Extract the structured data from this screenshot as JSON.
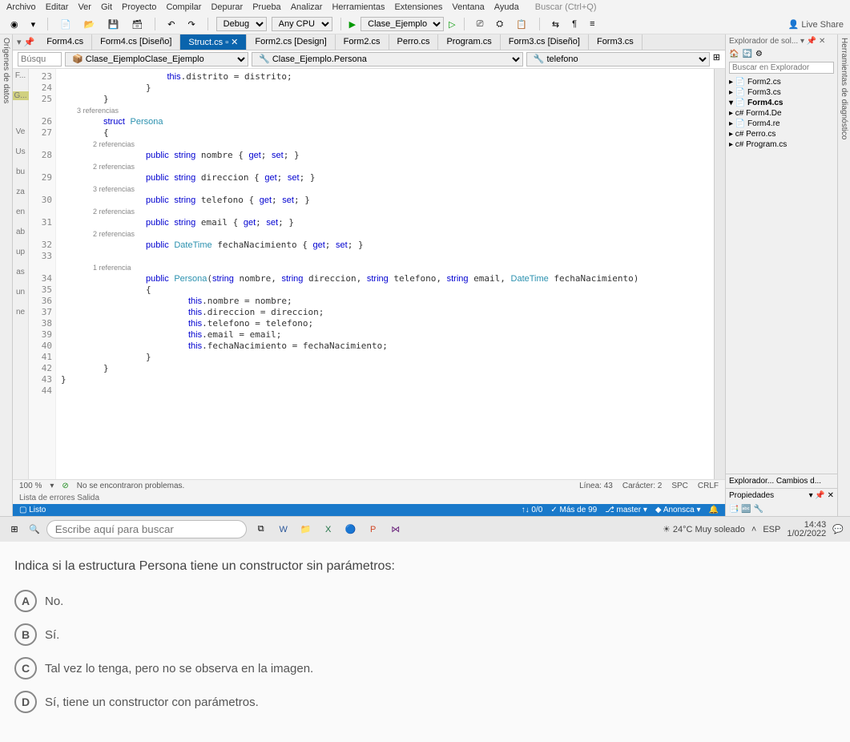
{
  "menubar": [
    "Archivo",
    "Editar",
    "Ver",
    "Git",
    "Proyecto",
    "Compilar",
    "Depurar",
    "Prueba",
    "Analizar",
    "Herramientas",
    "Extensiones",
    "Ventana",
    "Ayuda"
  ],
  "menuSearch": "Buscar (Ctrl+Q)",
  "toolbar": {
    "debug": "Debug",
    "anycpu": "Any CPU",
    "run": "Clase_Ejemplo",
    "liveshare": "Live Share"
  },
  "docTabs": [
    "Form4.cs",
    "Form4.cs [Diseño]",
    "Struct.cs",
    "Form2.cs [Design]",
    "Form2.cs",
    "Perro.cs",
    "Program.cs",
    "Form3.cs [Diseño]",
    "Form3.cs"
  ],
  "activeTabIndex": 2,
  "nav": {
    "searchPlaceholder": "Búsqu",
    "project": "Clase_Ejemplo",
    "classSel": "Clase_Ejemplo.Persona",
    "memberSel": "telefono"
  },
  "marginLabels": [
    "Ve",
    "Us",
    "bu",
    "za",
    "en",
    "ab",
    "up",
    "as",
    "un",
    "ne"
  ],
  "marginTop": [
    "F...",
    "G..."
  ],
  "codeLines": [
    {
      "n": "23",
      "t": "                    this.distrito = distrito;",
      "cls": ""
    },
    {
      "n": "24",
      "t": "                }",
      "cls": ""
    },
    {
      "n": "25",
      "t": "        }",
      "cls": ""
    },
    {
      "n": "",
      "t": "        3 referencias",
      "cls": "ref"
    },
    {
      "n": "26",
      "t": "        struct Persona",
      "cls": "kw2"
    },
    {
      "n": "27",
      "t": "        {",
      "cls": ""
    },
    {
      "n": "",
      "t": "                2 referencias",
      "cls": "ref"
    },
    {
      "n": "28",
      "t": "                public string nombre { get; set; }",
      "cls": "kw"
    },
    {
      "n": "",
      "t": "                2 referencias",
      "cls": "ref"
    },
    {
      "n": "29",
      "t": "                public string direccion { get; set; }",
      "cls": "kw"
    },
    {
      "n": "",
      "t": "                3 referencias",
      "cls": "ref"
    },
    {
      "n": "30",
      "t": "                public string telefono { get; set; }",
      "cls": "kw"
    },
    {
      "n": "",
      "t": "                2 referencias",
      "cls": "ref"
    },
    {
      "n": "31",
      "t": "                public string email { get; set; }",
      "cls": "kw"
    },
    {
      "n": "",
      "t": "                2 referencias",
      "cls": "ref"
    },
    {
      "n": "32",
      "t": "                public DateTime fechaNacimiento { get; set; }",
      "cls": "kw"
    },
    {
      "n": "33",
      "t": "",
      "cls": ""
    },
    {
      "n": "",
      "t": "                1 referencia",
      "cls": "ref"
    },
    {
      "n": "34",
      "t": "                public Persona(string nombre, string direccion, string telefono, string email, DateTime fechaNacimiento)",
      "cls": "kw"
    },
    {
      "n": "35",
      "t": "                {",
      "cls": ""
    },
    {
      "n": "36",
      "t": "                        this.nombre = nombre;",
      "cls": ""
    },
    {
      "n": "37",
      "t": "                        this.direccion = direccion;",
      "cls": ""
    },
    {
      "n": "38",
      "t": "                        this.telefono = telefono;",
      "cls": ""
    },
    {
      "n": "39",
      "t": "                        this.email = email;",
      "cls": ""
    },
    {
      "n": "40",
      "t": "                        this.fechaNacimiento = fechaNacimiento;",
      "cls": ""
    },
    {
      "n": "41",
      "t": "                }",
      "cls": ""
    },
    {
      "n": "42",
      "t": "        }",
      "cls": ""
    },
    {
      "n": "43",
      "t": "}",
      "cls": ""
    },
    {
      "n": "44",
      "t": "",
      "cls": ""
    }
  ],
  "status": {
    "zoom": "100 %",
    "issues": "No se encontraron problemas.",
    "line": "Línea: 43",
    "char": "Carácter: 2",
    "spc": "SPC",
    "crlf": "CRLF"
  },
  "errorTabs": "Lista de errores   Salida",
  "vsBottom": {
    "left": "Listo",
    "pos": "↑↓ 0/0",
    "commits": "✓ Más de 99",
    "branch": "master",
    "repo": "Anonsca"
  },
  "rightPanel": {
    "title": "Explorador de sol...",
    "searchPlaceholder": "Buscar en Explorador",
    "tree": [
      "▸ 📄 Form2.cs",
      "▸ 📄 Form3.cs",
      "▾ 📄 Form4.cs",
      "   ▸ c# Form4.De",
      "   ▸ 📄 Form4.re",
      "▸ c# Perro.cs",
      "▸ c# Program.cs"
    ],
    "section2": "Explorador...   Cambios d...",
    "props": "Propiedades"
  },
  "taskbar": {
    "searchPlaceholder": "Escribe aquí para buscar",
    "weather": "24°C  Muy soleado",
    "lang": "ESP",
    "time": "14:43",
    "date": "1/02/2022"
  },
  "question": {
    "prompt": "Indica si la estructura Persona tiene un constructor sin parámetros:",
    "options": [
      {
        "key": "A",
        "text": "No."
      },
      {
        "key": "B",
        "text": "Sí."
      },
      {
        "key": "C",
        "text": "Tal vez lo tenga, pero no se observa en la imagen."
      },
      {
        "key": "D",
        "text": "Sí, tiene un constructor con parámetros."
      }
    ]
  }
}
